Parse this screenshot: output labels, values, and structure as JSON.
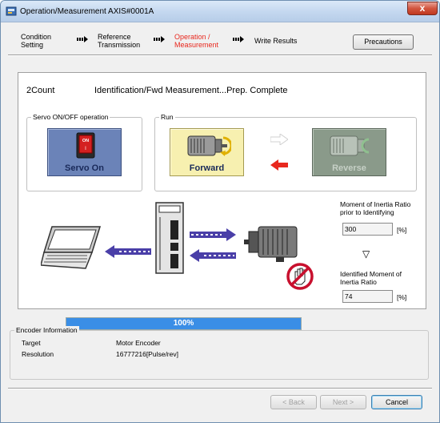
{
  "window": {
    "title": "Operation/Measurement AXIS#0001A",
    "close_glyph": "x"
  },
  "wizard_steps": [
    {
      "label_l1": "Condition",
      "label_l2": "Setting",
      "active": false
    },
    {
      "label_l1": "Reference",
      "label_l2": "Transmission",
      "active": false
    },
    {
      "label_l1": "Operation /",
      "label_l2": "Measurement",
      "active": true
    },
    {
      "label_l1": "Write Results",
      "label_l2": "",
      "active": false
    }
  ],
  "precautions_label": "Precautions",
  "status": {
    "count": "2Count",
    "message": "Identification/Fwd Measurement...Prep. Complete"
  },
  "servo_group": {
    "label": "Servo ON/OFF operation",
    "servo_on_label": "Servo On",
    "switch_on_text": "ON",
    "switch_off_text": "I"
  },
  "run_group": {
    "label": "Run",
    "forward_label": "Forward",
    "reverse_label": "Reverse"
  },
  "inertia": {
    "prior_label_l1": "Moment of Inertia Ratio",
    "prior_label_l2": "prior to Identifying",
    "prior_value": "300",
    "prior_unit": "[%]",
    "down_arrow": "▽",
    "identified_label_l1": "Identified Moment of",
    "identified_label_l2": "Inertia Ratio",
    "identified_value": "74",
    "identified_unit": "[%]"
  },
  "progress": {
    "percent": 100,
    "label": "100%"
  },
  "encoder": {
    "group_label": "Encoder Information",
    "target_label": "Target",
    "target_value": "Motor Encoder",
    "resolution_label": "Resolution",
    "resolution_value": "16777216[Pulse/rev]"
  },
  "footer": {
    "back_label": "< Back",
    "next_label": "Next >",
    "cancel_label": "Cancel"
  },
  "colors": {
    "active_step": "#e8281e",
    "progress_fill": "#3a8ee6",
    "servo_button_bg": "#6b83b8",
    "forward_button_bg": "#f7f0b0",
    "reverse_button_bg": "#8a9a8a",
    "arrow_fill": "#4a3fa8"
  }
}
